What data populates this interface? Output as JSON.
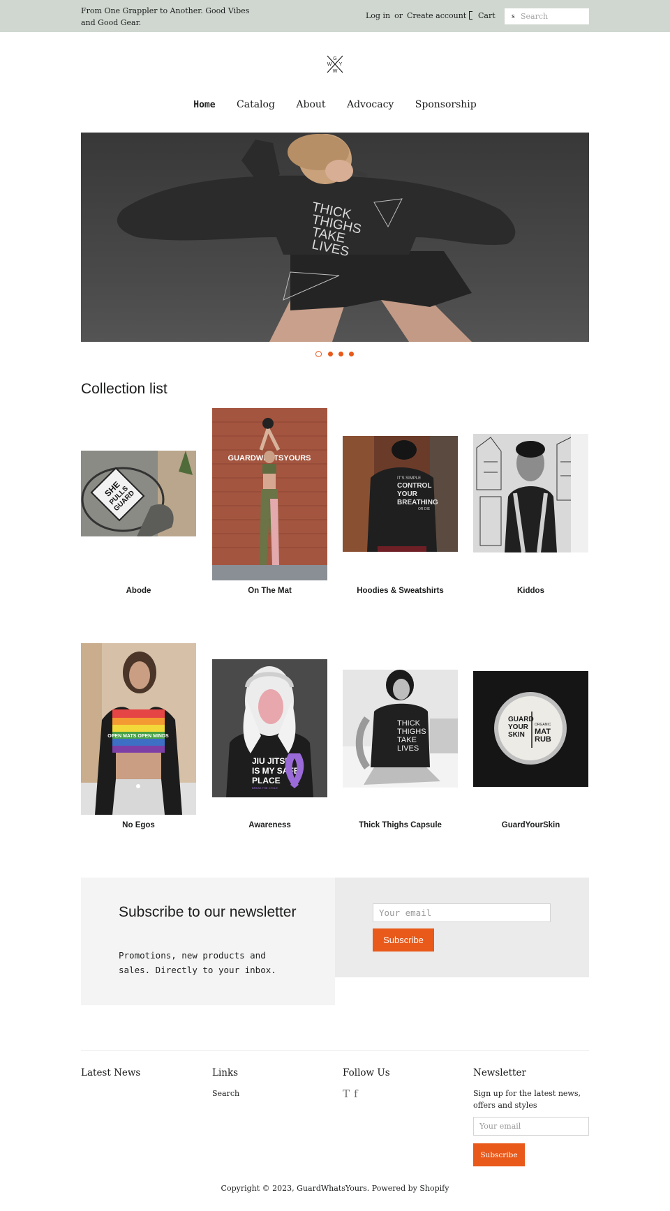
{
  "announcement": {
    "tagline": "From One Grappler to Another. Good Vibes and Good Gear.",
    "login": "Log in",
    "or": "or",
    "create_account": "Create account",
    "cart": "Cart",
    "search_placeholder": "Search",
    "search_icon_glyph": "s"
  },
  "logo": {
    "letters": [
      "G",
      "W",
      "Y",
      "W"
    ],
    "icon": "crossed-letters-logo"
  },
  "nav": {
    "items": [
      {
        "label": "Home",
        "active": true
      },
      {
        "label": "Catalog",
        "active": false
      },
      {
        "label": "About",
        "active": false
      },
      {
        "label": "Advocacy",
        "active": false
      },
      {
        "label": "Sponsorship",
        "active": false
      }
    ]
  },
  "hero": {
    "shirt_text": [
      "THICK",
      "THIGHS",
      "TAKE",
      "LIVES"
    ],
    "slide_count": 4,
    "active_slide": 1
  },
  "collection": {
    "title": "Collection list",
    "items": [
      {
        "label": "Abode",
        "image_text": [
          "SHE",
          "PULLS",
          "GUARD"
        ]
      },
      {
        "label": "On The Mat",
        "image_text": [
          "GUARDWHATSYOURS"
        ]
      },
      {
        "label": "Hoodies & Sweatshirts",
        "image_text": [
          "IT'S SIMPLE",
          "CONTROL",
          "YOUR",
          "BREATHING",
          "OR DIE"
        ]
      },
      {
        "label": "Kiddos",
        "image_text": []
      },
      {
        "label": "No Egos",
        "image_text": [
          "OPEN MATS OPEN MINDS"
        ]
      },
      {
        "label": "Awareness",
        "image_text": [
          "JIU JITSU",
          "IS MY SAFE",
          "PLACE",
          "BREAK THE CYCLE"
        ]
      },
      {
        "label": "Thick Thighs Capsule",
        "image_text": [
          "THICK",
          "THIGHS",
          "TAKE",
          "LIVES"
        ]
      },
      {
        "label": "GuardYourSkin",
        "image_text": [
          "GUARD",
          "YOUR",
          "SKIN",
          "ORGANIC",
          "MAT",
          "RUB"
        ]
      }
    ]
  },
  "newsletter": {
    "title": "Subscribe to our newsletter",
    "subtitle": "Promotions, new products and sales. Directly to your inbox.",
    "placeholder": "Your email",
    "button": "Subscribe"
  },
  "footer": {
    "latest_news": "Latest News",
    "links_title": "Links",
    "links": [
      "Search"
    ],
    "follow_title": "Follow Us",
    "social": [
      "T",
      "f"
    ],
    "newsletter_title": "Newsletter",
    "newsletter_text": "Sign up for the latest news, offers and styles",
    "newsletter_placeholder": "Your email",
    "newsletter_button": "Subscribe",
    "copyright": "Copyright © 2023, GuardWhatsYours. Powered by Shopify"
  },
  "colors": {
    "accent": "#e8591a",
    "topbar": "#cfd7d0",
    "text": "#1c1d1d"
  }
}
